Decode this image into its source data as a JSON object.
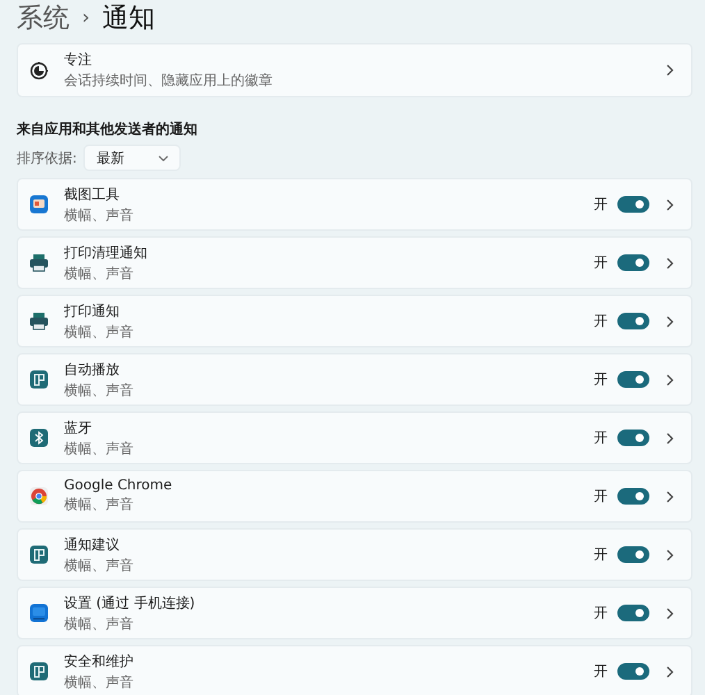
{
  "breadcrumb": {
    "parent": "系统",
    "separator": "›",
    "current": "通知"
  },
  "focus": {
    "title": "专注",
    "subtitle": "会话持续时间、隐藏应用上的徽章"
  },
  "section_title": "来自应用和其他发送者的通知",
  "sort": {
    "label": "排序依据:",
    "value": "最新"
  },
  "apps": [
    {
      "kind": "snip",
      "name": "截图工具",
      "detail": "横幅、声音",
      "state_label": "开",
      "on": true
    },
    {
      "kind": "printer",
      "name": "打印清理通知",
      "detail": "横幅、声音",
      "state_label": "开",
      "on": true
    },
    {
      "kind": "printer",
      "name": "打印通知",
      "detail": "横幅、声音",
      "state_label": "开",
      "on": true
    },
    {
      "kind": "tile",
      "name": "自动播放",
      "detail": "横幅、声音",
      "state_label": "开",
      "on": true
    },
    {
      "kind": "bluetooth",
      "name": "蓝牙",
      "detail": "横幅、声音",
      "state_label": "开",
      "on": true
    },
    {
      "kind": "chrome",
      "name": "Google Chrome",
      "detail": "横幅、声音",
      "state_label": "开",
      "on": true
    },
    {
      "kind": "tile",
      "name": "通知建议",
      "detail": "横幅、声音",
      "state_label": "开",
      "on": true
    },
    {
      "kind": "settings",
      "name": "设置 (通过 手机连接)",
      "detail": "横幅、声音",
      "state_label": "开",
      "on": true
    },
    {
      "kind": "tile",
      "name": "安全和维护",
      "detail": "横幅、声音",
      "state_label": "开",
      "on": true
    }
  ]
}
